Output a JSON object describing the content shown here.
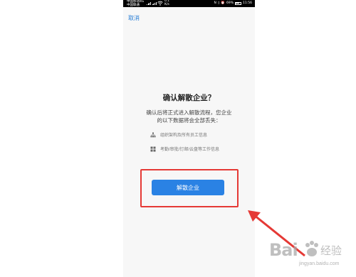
{
  "statusbar": {
    "carrier_line1": "中国移动4G",
    "carrier_line2": "中国联通",
    "net_speed_value": "0.1",
    "net_speed_unit": "K/s",
    "battery": "69%",
    "time": "11:56"
  },
  "header": {
    "cancel_label": "取消"
  },
  "dialog": {
    "title": "确认解散企业？",
    "description_line1": "确认后将正式进入解散流程，您企业",
    "description_line2": "的以下数据将会全部丢失："
  },
  "features": [
    {
      "icon": "org-chart-icon",
      "label": "组织架构及所有员工信息"
    },
    {
      "icon": "grid-apps-icon",
      "label": "考勤/审批/钉邮/云盘等工作信息"
    }
  ],
  "actions": {
    "dissolve_label": "解散企业"
  },
  "annotations": {
    "highlight_color": "#e53935"
  },
  "watermark": {
    "brand": "Bai",
    "brand_cn": "经验",
    "url": "jingyan.baidu.com"
  },
  "colors": {
    "accent": "#2a82e4",
    "link": "#2a7fd6",
    "annotation": "#e53935"
  }
}
